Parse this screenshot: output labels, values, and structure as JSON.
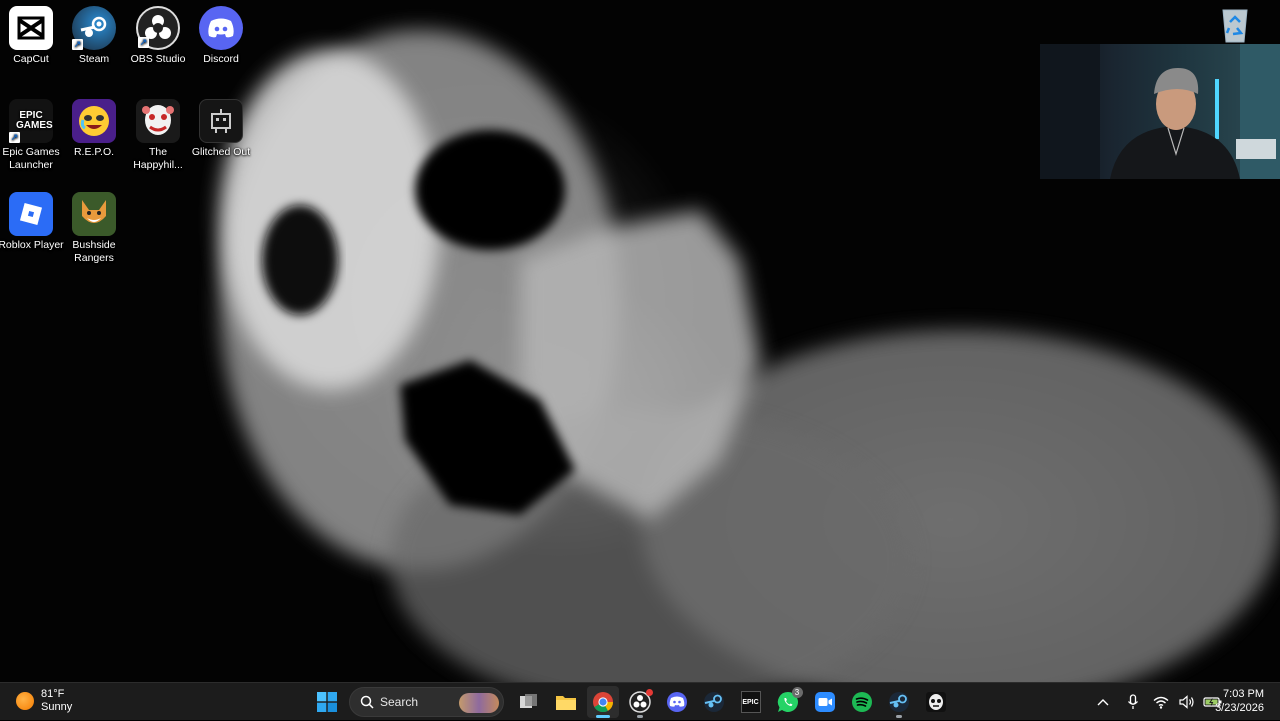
{
  "desktop": {
    "icons": [
      {
        "label": "CapCut"
      },
      {
        "label": "Steam"
      },
      {
        "label": "OBS Studio"
      },
      {
        "label": "Discord"
      },
      {
        "label": "Epic Games Launcher",
        "glyph": "EPIC GAMES"
      },
      {
        "label": "R.E.P.O."
      },
      {
        "label": "The Happyhil..."
      },
      {
        "label": "Glitched Out"
      },
      {
        "label": "Roblox Player"
      },
      {
        "label": "Bushside Rangers"
      }
    ]
  },
  "taskbar": {
    "weather": {
      "temp": "81°F",
      "condition": "Sunny"
    },
    "search": {
      "placeholder": "Search"
    },
    "pinned": [
      {
        "icon": "windows-start-icon"
      },
      {
        "icon": "task-view-icon"
      },
      {
        "icon": "file-explorer-icon"
      },
      {
        "icon": "chrome-icon",
        "active": true
      },
      {
        "icon": "obs-icon"
      },
      {
        "icon": "discord-icon"
      },
      {
        "icon": "steam-icon"
      },
      {
        "icon": "epic-games-icon",
        "glyph": "EPIC"
      },
      {
        "icon": "whatsapp-icon",
        "badge": "3"
      },
      {
        "icon": "zoom-icon"
      },
      {
        "icon": "spotify-icon"
      },
      {
        "icon": "steam-icon"
      },
      {
        "icon": "game-icon"
      }
    ],
    "clock": {
      "time": "7:03 PM",
      "date": "3/23/2026"
    }
  },
  "colors": {
    "taskbar_bg": "#1c1c1c",
    "accent": "#60cdff",
    "discord": "#5865f2",
    "spotify": "#1db954",
    "whatsapp": "#25d366",
    "roblox": "#2b6cf6"
  }
}
